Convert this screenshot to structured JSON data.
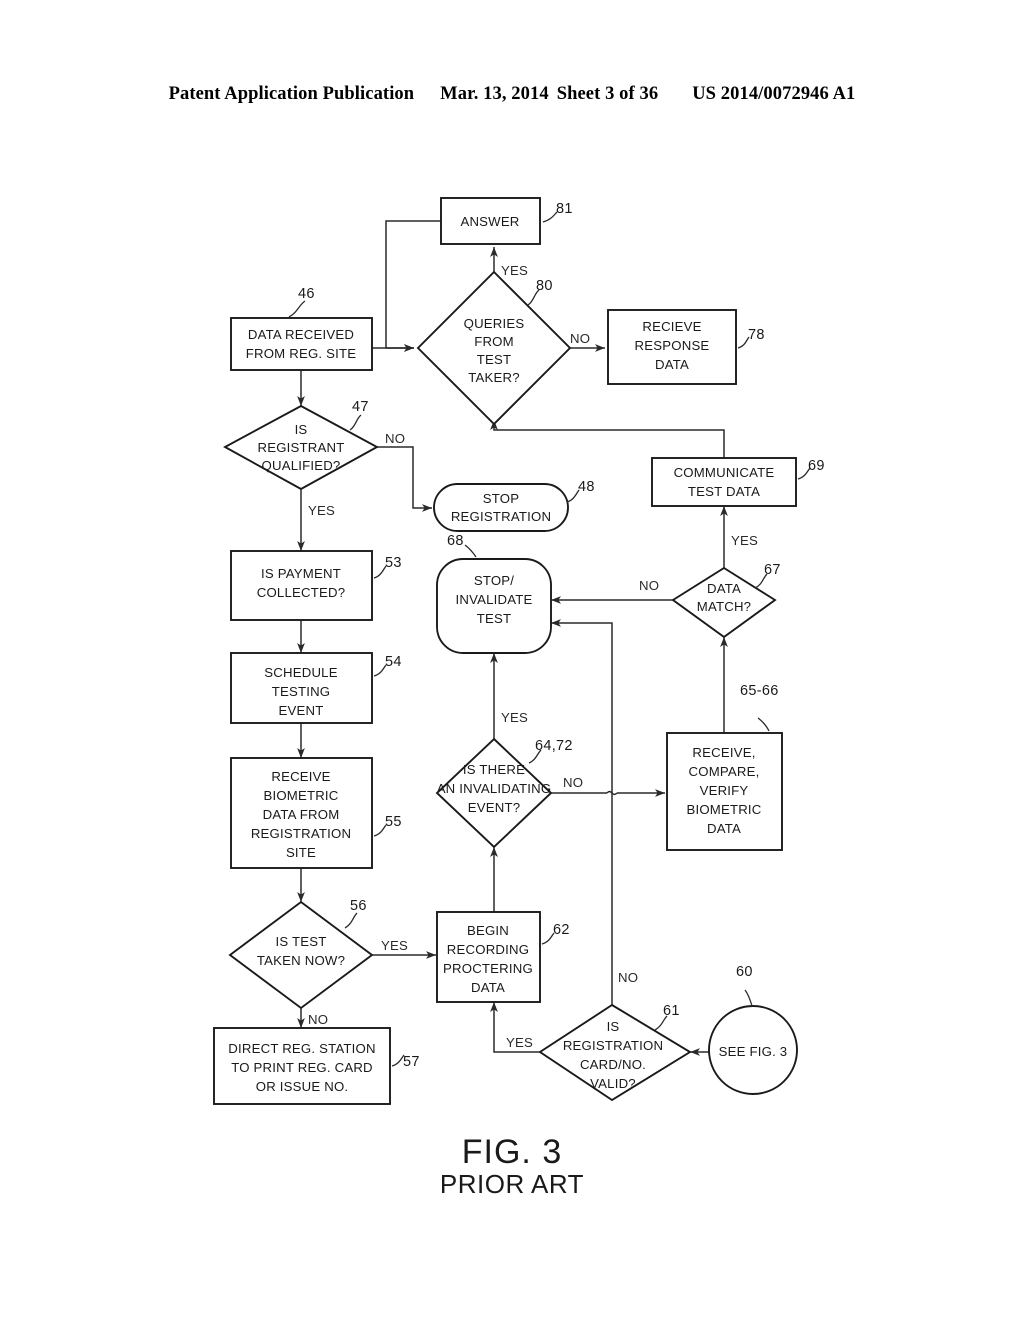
{
  "header": {
    "publication": "Patent Application Publication",
    "date": "Mar. 13, 2014",
    "sheet": "Sheet 3 of 36",
    "docnum": "US 2014/0072946 A1"
  },
  "figure": {
    "caption": "FIG. 3",
    "subcaption": "PRIOR ART"
  },
  "nodes": {
    "answer": {
      "ref": "81",
      "lines": [
        "ANSWER"
      ]
    },
    "queries": {
      "ref": "80",
      "lines": [
        "QUERIES",
        "FROM",
        "TEST",
        "TAKER?"
      ]
    },
    "recieve_response": {
      "ref": "78",
      "lines": [
        "RECIEVE",
        "RESPONSE",
        "DATA"
      ]
    },
    "data_received": {
      "ref": "46",
      "lines": [
        "DATA RECEIVED",
        "FROM REG. SITE"
      ]
    },
    "is_registrant": {
      "ref": "47",
      "lines": [
        "IS",
        "REGISTRANT",
        "QUALIFIED?"
      ]
    },
    "stop_registration": {
      "ref": "48",
      "lines": [
        "STOP",
        "REGISTRATION"
      ]
    },
    "communicate": {
      "ref": "69",
      "lines": [
        "COMMUNICATE",
        "TEST DATA"
      ]
    },
    "data_match": {
      "ref": "67",
      "lines": [
        "DATA",
        "MATCH?"
      ]
    },
    "is_payment": {
      "ref": "53",
      "lines": [
        "IS PAYMENT",
        "COLLECTED?"
      ]
    },
    "stop_invalidate": {
      "ref": "68",
      "lines": [
        "STOP/",
        "INVALIDATE",
        "TEST"
      ]
    },
    "schedule": {
      "ref": "54",
      "lines": [
        "SCHEDULE",
        "TESTING",
        "EVENT"
      ]
    },
    "receive_biometric": {
      "ref": "55",
      "lines": [
        "RECEIVE",
        "BIOMETRIC",
        "DATA FROM",
        "REGISTRATION",
        "SITE"
      ]
    },
    "invalidating_event": {
      "ref": "64,72",
      "lines": [
        "IS THERE",
        "AN INVALIDATING",
        "EVENT?"
      ]
    },
    "receive_compare": {
      "ref": "65-66",
      "lines": [
        "RECEIVE,",
        "COMPARE,",
        "VERIFY",
        "BIOMETRIC",
        "DATA"
      ]
    },
    "is_test_taken": {
      "ref": "56",
      "lines": [
        "IS TEST",
        "TAKEN NOW?"
      ]
    },
    "begin_recording": {
      "ref": "62",
      "lines": [
        "BEGIN",
        "RECORDING",
        "PROCTERING",
        "DATA"
      ]
    },
    "is_reg_card": {
      "ref": "61",
      "lines": [
        "IS",
        "REGISTRATION",
        "CARD/NO.",
        "VALID?"
      ]
    },
    "see_fig3": {
      "ref": "60",
      "lines": [
        "SEE FIG. 3"
      ]
    },
    "direct_reg": {
      "ref": "57",
      "lines": [
        "DIRECT REG. STATION",
        "TO PRINT REG. CARD",
        "OR ISSUE NO."
      ]
    }
  },
  "edge_labels": {
    "queries_yes": "YES",
    "queries_no": "NO",
    "registrant_no": "NO",
    "registrant_yes": "YES",
    "data_match_yes": "YES",
    "data_match_no": "NO",
    "invalidating_yes": "YES",
    "invalidating_no": "NO",
    "test_taken_yes": "YES",
    "test_taken_no": "NO",
    "reg_card_no": "NO",
    "reg_card_yes": "YES"
  },
  "colors": {
    "ink": "#1a1a1a",
    "line": "#2a2a2a",
    "paper": "#ffffff"
  }
}
